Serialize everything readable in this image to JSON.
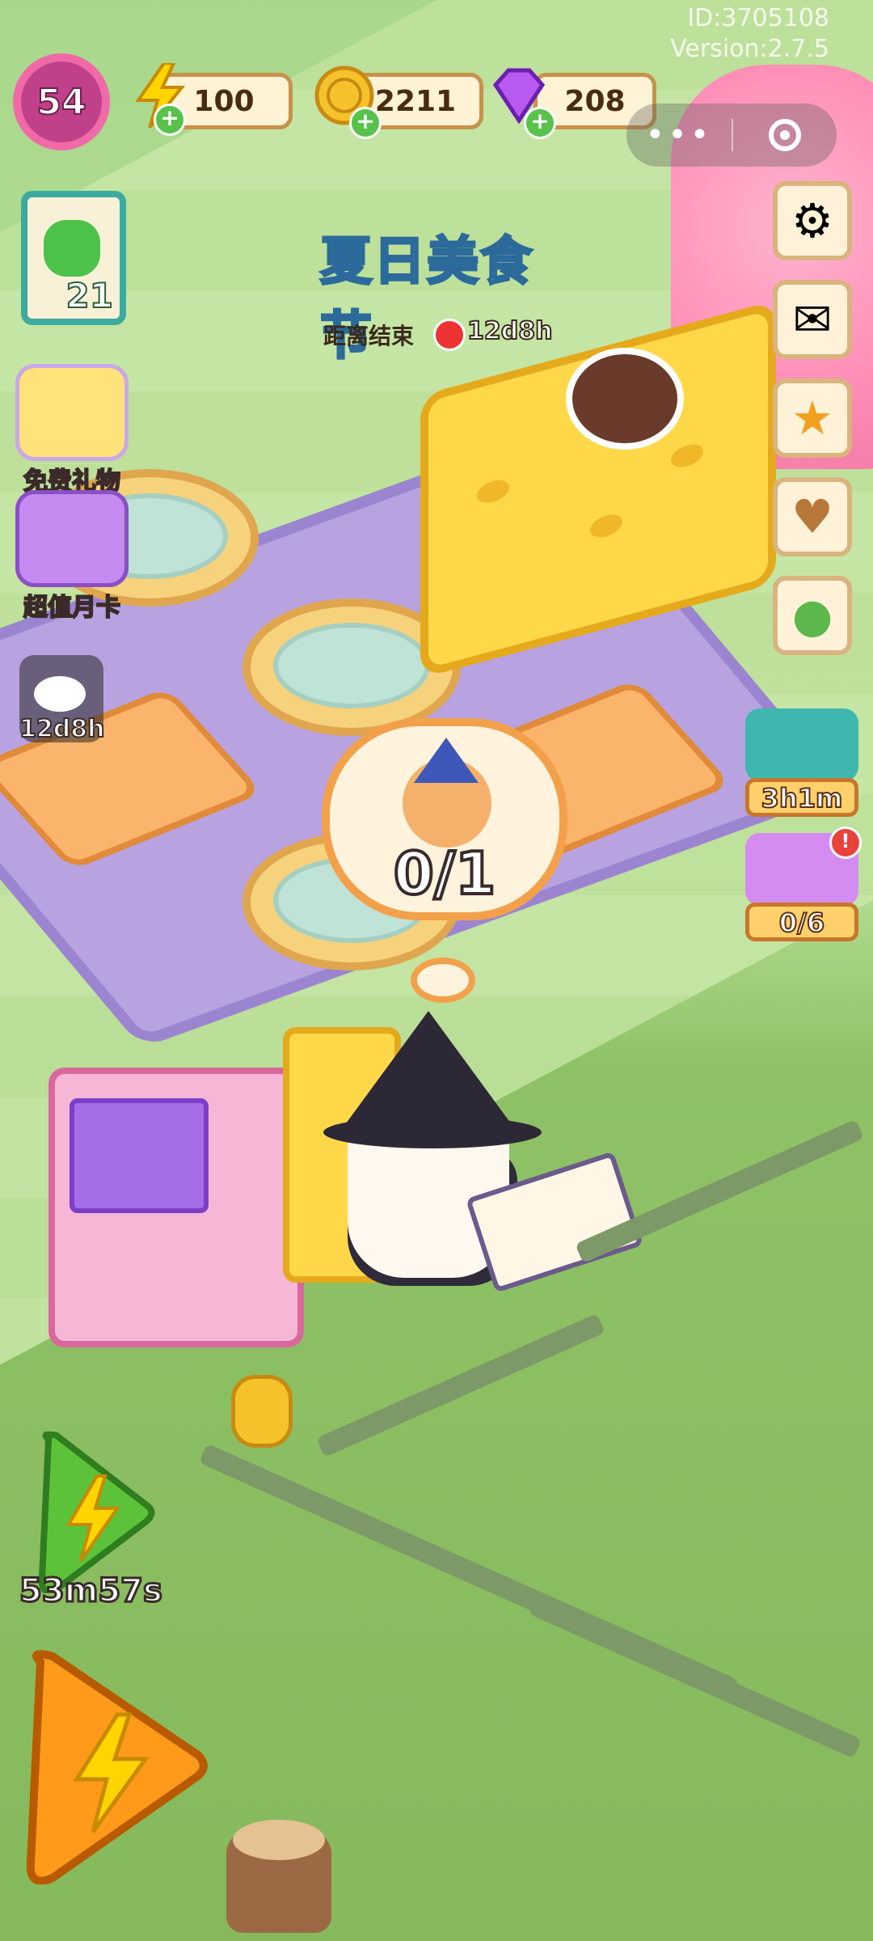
{
  "hud": {
    "level": "54",
    "energy": "100",
    "coins": "2211",
    "gems": "208",
    "id_line": "ID:3705108",
    "version_line": "Version:2.7.5",
    "menu_dots": "•••"
  },
  "quest": {
    "count": "21"
  },
  "left_menu": {
    "free_gift": "免费礼物",
    "monthly_card": "超值月卡",
    "chat_timer": "12d8h"
  },
  "event": {
    "title": "夏日美食节",
    "end_label": "距离结束",
    "time_left": "12d8h"
  },
  "order": {
    "progress": "0/1"
  },
  "right_promos": {
    "sale_timer": "3h1m",
    "jar_progress": "0/6",
    "jar_badge": "!"
  },
  "energy_buttons": {
    "green_timer": "53m57s"
  },
  "colors": {
    "level_ring": "#f06aa8",
    "energy_yellow": "#ffd400",
    "coin_gold": "#f5c22b",
    "gem_purple": "#b85af0",
    "plus_green": "#58c24a"
  },
  "icons": {
    "settings": "gear-icon",
    "mail": "mail-icon",
    "achievement": "star-medal-icon",
    "album": "heart-book-icon",
    "guide": "green-book-icon"
  }
}
